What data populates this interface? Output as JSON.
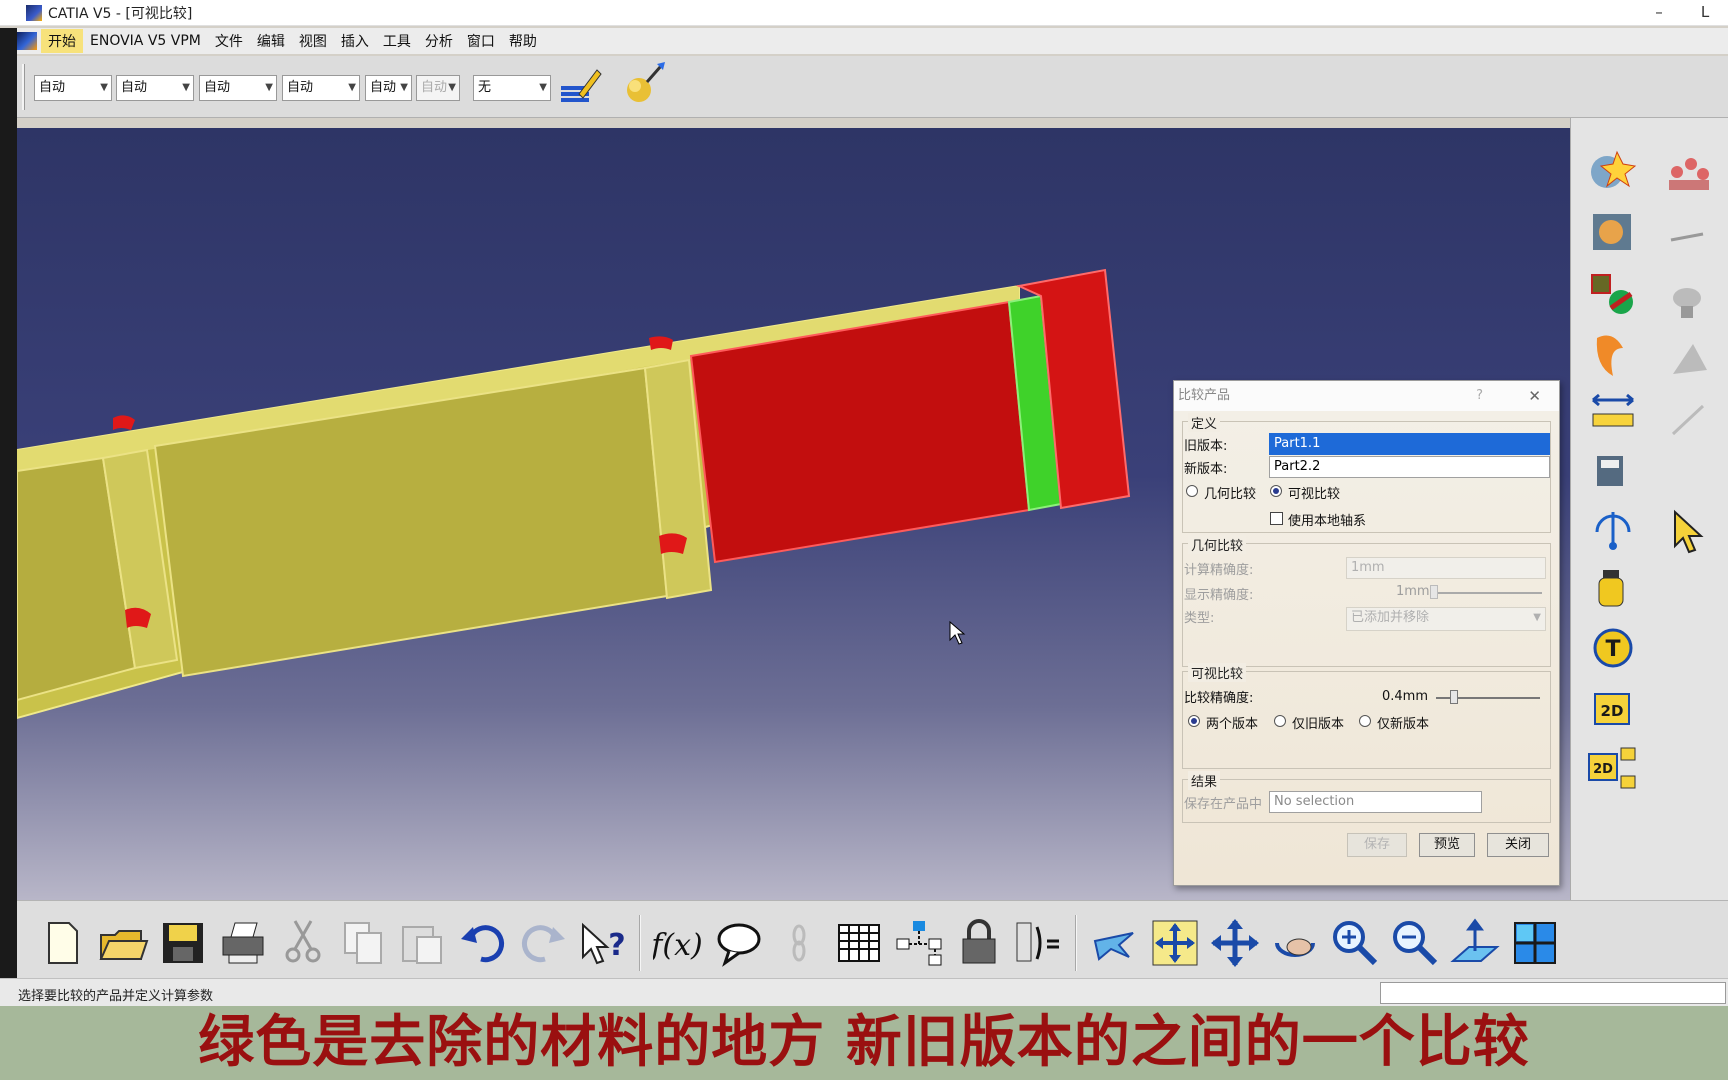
{
  "window": {
    "title": "CATIA V5 - [可视比较]",
    "min_glyph": "–",
    "max_glyph": "L"
  },
  "menu": {
    "items": [
      "开始",
      "ENOVIA V5 VPM",
      "文件",
      "编辑",
      "视图",
      "插入",
      "工具",
      "分析",
      "窗口",
      "帮助"
    ]
  },
  "property_toolbar": {
    "combos": [
      "自动",
      "自动",
      "自动",
      "自动",
      "自动",
      "自动",
      "无"
    ],
    "combo_disabled_index": 5
  },
  "dialog": {
    "title": "比较产品",
    "help_glyph": "?",
    "close_glyph": "✕",
    "definition": {
      "group_label": "定义",
      "old_label": "旧版本:",
      "old_value": "Part1.1",
      "new_label": "新版本:",
      "new_value": "Part2.2",
      "mode_geometric": "几何比较",
      "mode_visual": "可视比较",
      "mode_selected": "visual",
      "local_axis_label": "使用本地轴系",
      "local_axis_checked": false
    },
    "geometric": {
      "group_label": "几何比较",
      "compute_precision_label": "计算精确度:",
      "compute_precision_value": "1mm",
      "display_precision_label": "显示精确度:",
      "display_precision_value": "1mm",
      "type_label": "类型:",
      "type_value": "已添加并移除"
    },
    "visual": {
      "group_label": "可视比较",
      "precision_label": "比较精确度:",
      "precision_value": "0.4mm",
      "opt_both": "两个版本",
      "opt_old": "仅旧版本",
      "opt_new": "仅新版本",
      "selected": "both"
    },
    "result": {
      "group_label": "结果",
      "save_label": "保存在产品中",
      "save_placeholder": "No selection"
    },
    "buttons": {
      "save": "保存",
      "preview": "预览",
      "close": "关闭"
    }
  },
  "status": {
    "text": "选择要比较的产品并定义计算参数"
  },
  "subtitle": "绿色是去除的材料的地方  新旧版本的之间的一个比较",
  "colors": {
    "accent_menu": "#f7e27b",
    "model_yellow": "#c9c24a",
    "model_red": "#d41414",
    "model_green": "#3fd22a",
    "subtitle_red": "#9a1010",
    "selection_blue": "#1e6ad8"
  },
  "icons": {
    "right_toolbar": [
      "render-icon",
      "assembly-icon",
      "scene-icon",
      "texture-icon",
      "multicolor-icon",
      "wizard-icon",
      "fit-icon",
      "measure-icon",
      "measure-between-icon",
      "pump-icon",
      "select-icon",
      "catalog-icon",
      "weight-icon",
      "text-icon",
      "2d-icon",
      "2d-multi-icon"
    ],
    "bottom_toolbar": [
      "new-icon",
      "open-icon",
      "save-icon",
      "print-icon",
      "cut-icon",
      "copy-icon",
      "paste-icon",
      "undo-icon",
      "redo-icon",
      "whats-this-icon",
      "formula-icon",
      "comment-icon",
      "link-icon",
      "table-icon",
      "tree-icon",
      "lock-icon",
      "parameter-icon",
      "fly-icon",
      "fit-all-icon",
      "pan-icon",
      "rotate-icon",
      "zoom-in-icon",
      "zoom-out-icon",
      "normal-view-icon",
      "views-icon"
    ]
  }
}
